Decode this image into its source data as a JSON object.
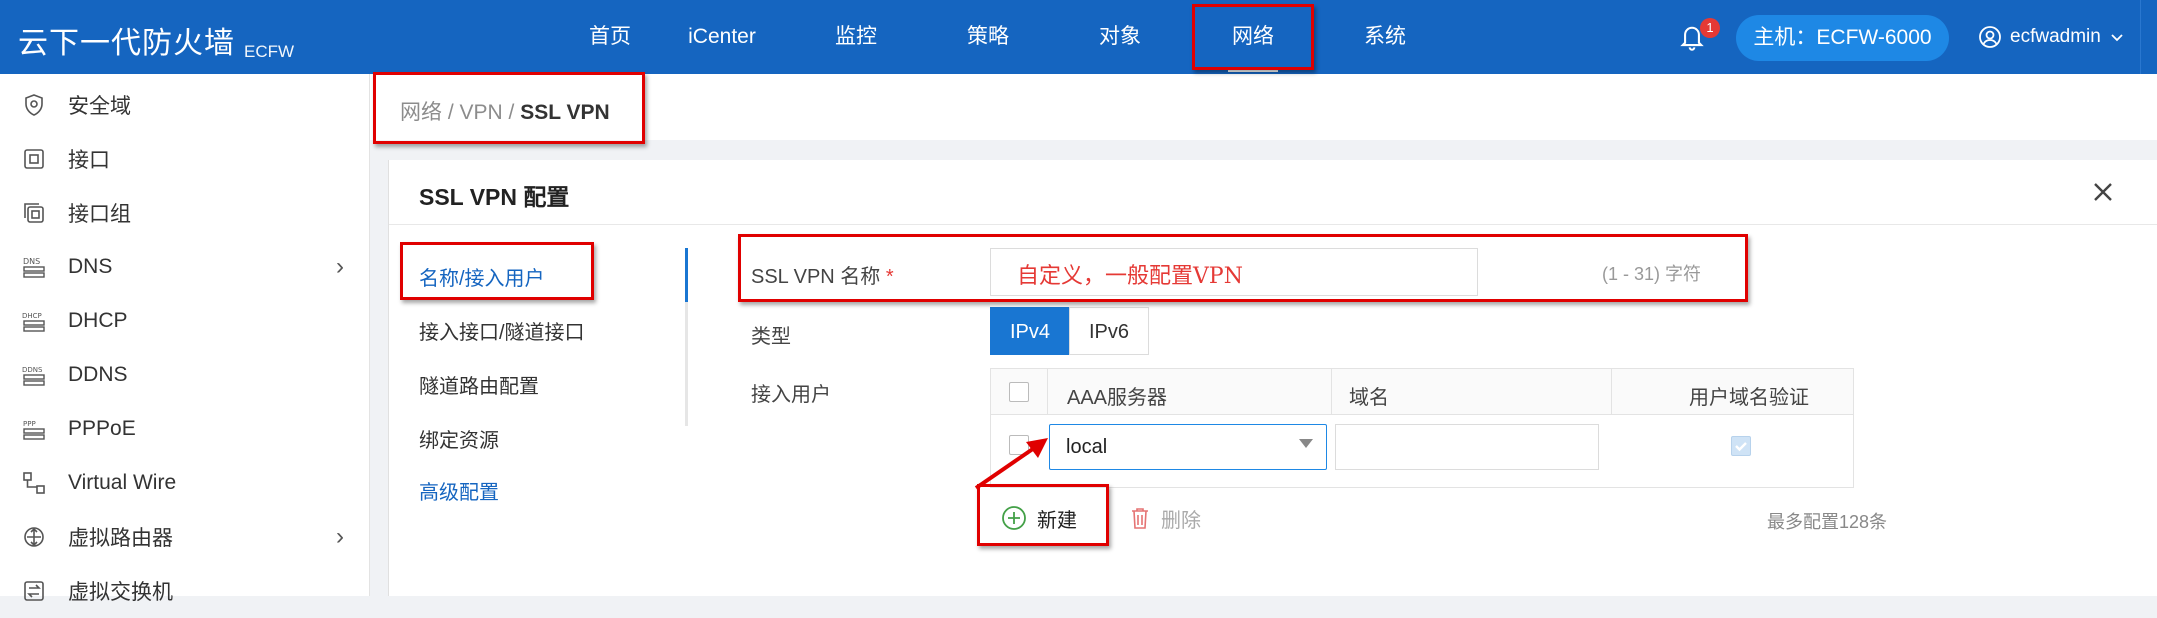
{
  "topbar": {
    "brand": "云下一代防火墙",
    "brand_sub": "ECFW",
    "nav": [
      "首页",
      "iCenter",
      "监控",
      "策略",
      "对象",
      "网络",
      "系统"
    ],
    "active_nav": "网络",
    "notification_count": "1",
    "host": "主机：ECFW-6000",
    "user": "ecfwadmin"
  },
  "sidebar": {
    "items": [
      {
        "label": "安全域",
        "icon": "shield-icon",
        "has_children": false
      },
      {
        "label": "接口",
        "icon": "interface-icon",
        "has_children": false
      },
      {
        "label": "接口组",
        "icon": "interface-group-icon",
        "has_children": false
      },
      {
        "label": "DNS",
        "icon": "dns-icon",
        "has_children": true
      },
      {
        "label": "DHCP",
        "icon": "dhcp-icon",
        "has_children": false
      },
      {
        "label": "DDNS",
        "icon": "ddns-icon",
        "has_children": false
      },
      {
        "label": "PPPoE",
        "icon": "pppoe-icon",
        "has_children": false
      },
      {
        "label": "Virtual Wire",
        "icon": "virtual-wire-icon",
        "has_children": false
      },
      {
        "label": "虚拟路由器",
        "icon": "virtual-router-icon",
        "has_children": true
      },
      {
        "label": "虚拟交换机",
        "icon": "virtual-switch-icon",
        "has_children": false
      }
    ]
  },
  "breadcrumb": {
    "part1": "网络",
    "sep": " / ",
    "part2": "VPN",
    "current": "SSL VPN"
  },
  "panel": {
    "title": "SSL VPN 配置",
    "menu": [
      "名称/接入用户",
      "接入接口/隧道接口",
      "隧道路由配置",
      "绑定资源",
      "高级配置"
    ],
    "active_menu": "名称/接入用户",
    "form": {
      "name_label": "SSL VPN 名称",
      "required_mark": "*",
      "name_annotation": "自定义，一般配置VPN",
      "name_hint": "(1 - 31) 字符",
      "type_label": "类型",
      "type_options": [
        "IPv4",
        "IPv6"
      ],
      "type_selected": "IPv4",
      "users_label": "接入用户"
    },
    "table": {
      "headers": [
        "AAA服务器",
        "域名",
        "用户域名验证"
      ],
      "rows": [
        {
          "aaa_server": "local",
          "domain": "",
          "verify": true
        }
      ]
    },
    "actions": {
      "new_label": "新建",
      "delete_label": "删除",
      "limit_text": "最多配置128条"
    }
  },
  "colors": {
    "brand_blue": "#1565c0",
    "accent_blue": "#1976d2",
    "annotation_red": "#e00000"
  }
}
